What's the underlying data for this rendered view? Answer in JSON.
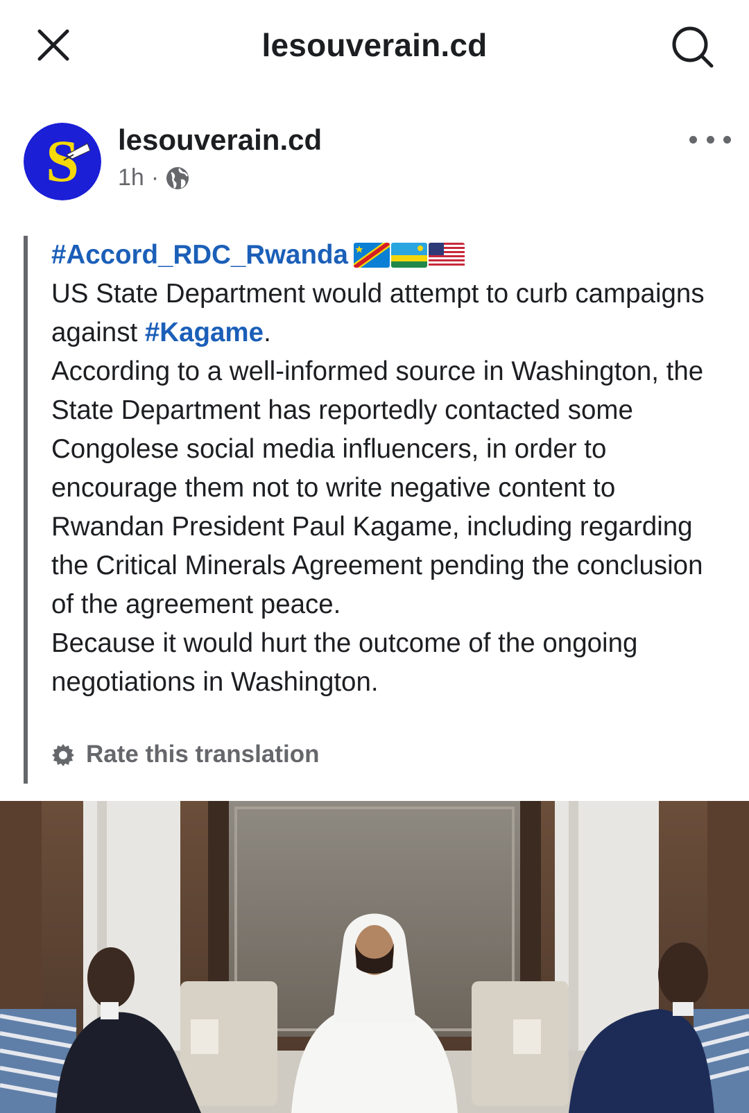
{
  "topbar": {
    "title": "lesouverain.cd"
  },
  "post": {
    "page_name": "lesouverain.cd",
    "time": "1h",
    "separator": "·",
    "hashtag_title": "#Accord_RDC_Rwanda",
    "flags": [
      "DR Congo",
      "Rwanda",
      "USA"
    ],
    "line1": "US State Department would attempt to curb campaigns against ",
    "hashtag_kagame": "#Kagame",
    "line1_end": ".",
    "paragraph2": "According to a well-informed source in Washington, the State Department has reportedly contacted some Congolese social media influencers, in order to encourage them not to write negative content to Rwandan President Paul Kagame, including regarding the Critical Minerals Agreement pending the conclusion of the agreement peace.",
    "paragraph3": "Because it would hurt the outcome of the ongoing negotiations in Washington.",
    "rate_label": "Rate this translation"
  },
  "colors": {
    "hashtag": "#1b5fb8",
    "muted": "#65676b",
    "avatar_bg": "#1b1fd6",
    "avatar_letter": "#f5d90a"
  },
  "icons": [
    "close-icon",
    "search-icon",
    "globe-icon",
    "more-options-icon",
    "gear-icon"
  ]
}
